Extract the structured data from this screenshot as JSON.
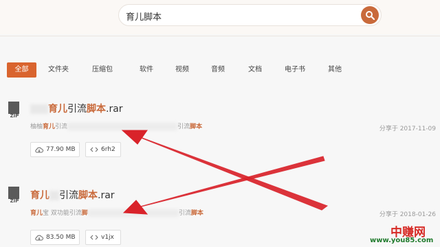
{
  "search": {
    "query": "育儿脚本"
  },
  "tabs": [
    {
      "label": "全部",
      "active": true
    },
    {
      "label": "文件夹"
    },
    {
      "label": "压缩包"
    },
    {
      "label": "软件"
    },
    {
      "label": "视频"
    },
    {
      "label": "音频"
    },
    {
      "label": "文档"
    },
    {
      "label": "电子书"
    },
    {
      "label": "其他"
    }
  ],
  "results": [
    {
      "type_badge": "ZIP",
      "title_hl1": "育儿",
      "title_mid": "引流",
      "title_hl2": "脚本",
      "title_ext": ".rar",
      "desc_pre": "柚柚",
      "desc_hl1": "育儿",
      "desc_mid": "引流",
      "desc_tail_plain": "引流",
      "desc_tail_hl": "脚本",
      "date": "分享于 2017-11-09",
      "size": "77.90 MB",
      "code": "6rh2"
    },
    {
      "type_badge": "ZIP",
      "title_hl1": "育儿",
      "title_mid": "引流",
      "title_hl2": "脚本",
      "title_ext": ".rar",
      "desc_hl1": "育儿",
      "desc_mid": "宝 双功能引流",
      "desc_hl2": "脚",
      "desc_tail_plain": "引流",
      "desc_tail_hl": "脚本",
      "date": "分享于 2018-01-26",
      "size": "83.50 MB",
      "code": "v1jx"
    }
  ],
  "watermark": {
    "logo": "中赚网",
    "url": "www.you85.com"
  },
  "colors": {
    "accent": "#d9642e",
    "highlight": "#c96a3b",
    "arrow": "#d9232a"
  }
}
